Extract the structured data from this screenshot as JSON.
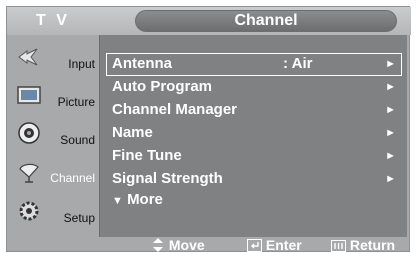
{
  "header": {
    "mode_label": "T V",
    "menu_title": "Channel"
  },
  "sidebar": {
    "items": [
      {
        "label": "Input",
        "icon": "input-icon"
      },
      {
        "label": "Picture",
        "icon": "picture-icon"
      },
      {
        "label": "Sound",
        "icon": "sound-icon"
      },
      {
        "label": "Channel",
        "icon": "channel-icon",
        "selected": true
      },
      {
        "label": "Setup",
        "icon": "setup-icon"
      }
    ]
  },
  "menu": {
    "items": [
      {
        "label": "Antenna",
        "value": ": Air",
        "arrow": "►",
        "selected": true
      },
      {
        "label": "Auto Program",
        "arrow": "►"
      },
      {
        "label": "Channel Manager",
        "arrow": "►"
      },
      {
        "label": "Name",
        "arrow": "►"
      },
      {
        "label": "Fine Tune",
        "arrow": "►"
      },
      {
        "label": "Signal Strength",
        "arrow": "►"
      }
    ],
    "more": {
      "glyph": "▼",
      "label": "More"
    }
  },
  "footer": {
    "move_label": "Move",
    "enter_label": "Enter",
    "return_label": "Return"
  },
  "colors": {
    "panel": "#7f8183",
    "frame": "#a7a9ab",
    "accent_white": "#ffffff"
  }
}
